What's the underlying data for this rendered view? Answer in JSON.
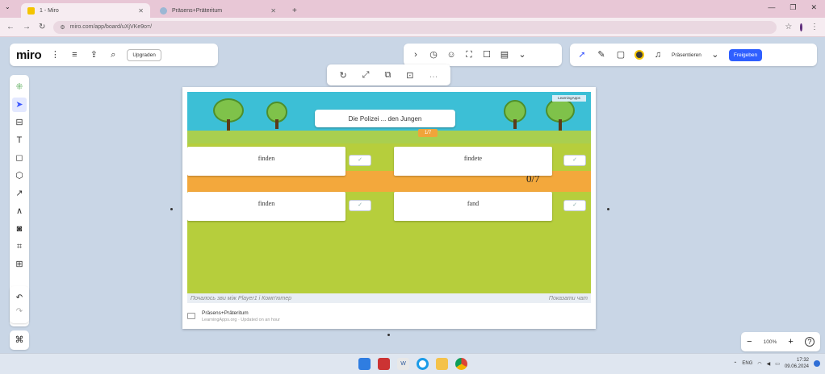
{
  "browser": {
    "tabs": [
      {
        "label": "1 - Miro",
        "active": true
      },
      {
        "label": "Präsens+Präteritum",
        "active": false
      }
    ],
    "url": "miro.com/app/board/uXjVKe9o=/",
    "new_tab": "+"
  },
  "miro": {
    "logo": "miro",
    "upgrade_label": "Upgraden",
    "present_label": "Präsentieren",
    "share_label": "Freigeben"
  },
  "game": {
    "question": "Die Polizei ... den Jungen",
    "progress": "1/7",
    "score": "0/7",
    "answers": [
      "finden",
      "findete",
      "finden",
      "fand"
    ],
    "check_mark": "✓",
    "caption_left": "Почалось зви мiж Player1 i Комп'ютер",
    "caption_right": "Показати чат"
  },
  "embed": {
    "title": "Präsens+Präteritum",
    "subtitle": "LearningApps.org · Updated on an hour"
  },
  "zoom": {
    "value": "100%",
    "minus": "−",
    "plus": "+",
    "help": "?"
  },
  "taskbar": {
    "lang": "ENG",
    "time": "17:32",
    "date": "09.06.2024"
  },
  "colors": {
    "accent": "#2f5fff",
    "canvas": "#c9d6e6",
    "game_green": "#b6ce3c",
    "sky": "#3cbfd6",
    "orange_band": "#f3a83c"
  }
}
